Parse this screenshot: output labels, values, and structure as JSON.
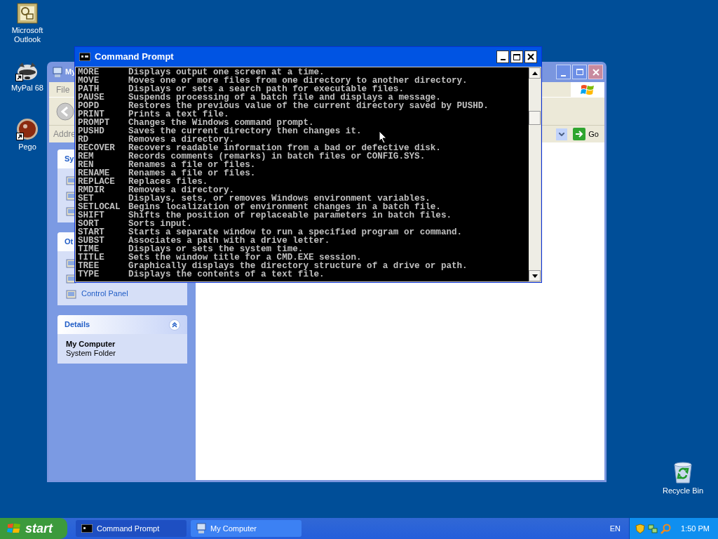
{
  "desktop_icons": [
    {
      "label": "Microsoft Outlook",
      "kind": "outlook",
      "shortcut": false
    },
    {
      "label": "MyPal 68",
      "kind": "raccoon",
      "shortcut": true
    },
    {
      "label": "Pego",
      "kind": "ball",
      "shortcut": true
    },
    {
      "label": "Recycle Bin",
      "kind": "recycle",
      "shortcut": false
    }
  ],
  "explorer": {
    "title": "My",
    "active": false,
    "menu": [
      "File"
    ],
    "address_label": "Addre",
    "go": "Go",
    "panels": [
      {
        "title": "Sy",
        "items": [
          {
            "kind": "folder"
          },
          {
            "kind": "folder"
          },
          {
            "kind": "folder"
          }
        ]
      },
      {
        "title": "Ot",
        "items": [
          {
            "kind": "folder"
          },
          {
            "kind": "folder"
          },
          {
            "kind": "folder",
            "label": "Control Panel"
          }
        ]
      },
      {
        "title": "Details",
        "lines": [
          "My Computer",
          "System Folder"
        ]
      }
    ]
  },
  "console": {
    "title": "Command Prompt",
    "active": true,
    "lines": [
      {
        "command": "MORE",
        "text": "Displays output one screen at a time."
      },
      {
        "command": "MOVE",
        "text": "Moves one or more files from one directory to another directory."
      },
      {
        "command": "PATH",
        "text": "Displays or sets a search path for executable files."
      },
      {
        "command": "PAUSE",
        "text": "Suspends processing of a batch file and displays a message."
      },
      {
        "command": "POPD",
        "text": "Restores the previous value of the current directory saved by PUSHD."
      },
      {
        "command": "PRINT",
        "text": "Prints a text file."
      },
      {
        "command": "PROMPT",
        "text": "Changes the Windows command prompt."
      },
      {
        "command": "PUSHD",
        "text": "Saves the current directory then changes it."
      },
      {
        "command": "RD",
        "text": "Removes a directory."
      },
      {
        "command": "RECOVER",
        "text": "Recovers readable information from a bad or defective disk."
      },
      {
        "command": "REM",
        "text": "Records comments (remarks) in batch files or CONFIG.SYS."
      },
      {
        "command": "REN",
        "text": "Renames a file or files."
      },
      {
        "command": "RENAME",
        "text": "Renames a file or files."
      },
      {
        "command": "REPLACE",
        "text": "Replaces files."
      },
      {
        "command": "RMDIR",
        "text": "Removes a directory."
      },
      {
        "command": "SET",
        "text": "Displays, sets, or removes Windows environment variables."
      },
      {
        "command": "SETLOCAL",
        "text": "Begins localization of environment changes in a batch file."
      },
      {
        "command": "SHIFT",
        "text": "Shifts the position of replaceable parameters in batch files."
      },
      {
        "command": "SORT",
        "text": "Sorts input."
      },
      {
        "command": "START",
        "text": "Starts a separate window to run a specified program or command."
      },
      {
        "command": "SUBST",
        "text": "Associates a path with a drive letter."
      },
      {
        "command": "TIME",
        "text": "Displays or sets the system time."
      },
      {
        "command": "TITLE",
        "text": "Sets the window title for a CMD.EXE session."
      },
      {
        "command": "TREE",
        "text": "Graphically displays the directory structure of a drive or path."
      },
      {
        "command": "TYPE",
        "text": "Displays the contents of a text file."
      }
    ]
  },
  "taskbar": {
    "start": "start",
    "tasks": [
      {
        "label": "Command Prompt",
        "kind": "console",
        "selected": true
      },
      {
        "label": "My Computer",
        "kind": "computer",
        "selected": false
      }
    ],
    "language": "EN",
    "clock": "1:50 PM"
  }
}
